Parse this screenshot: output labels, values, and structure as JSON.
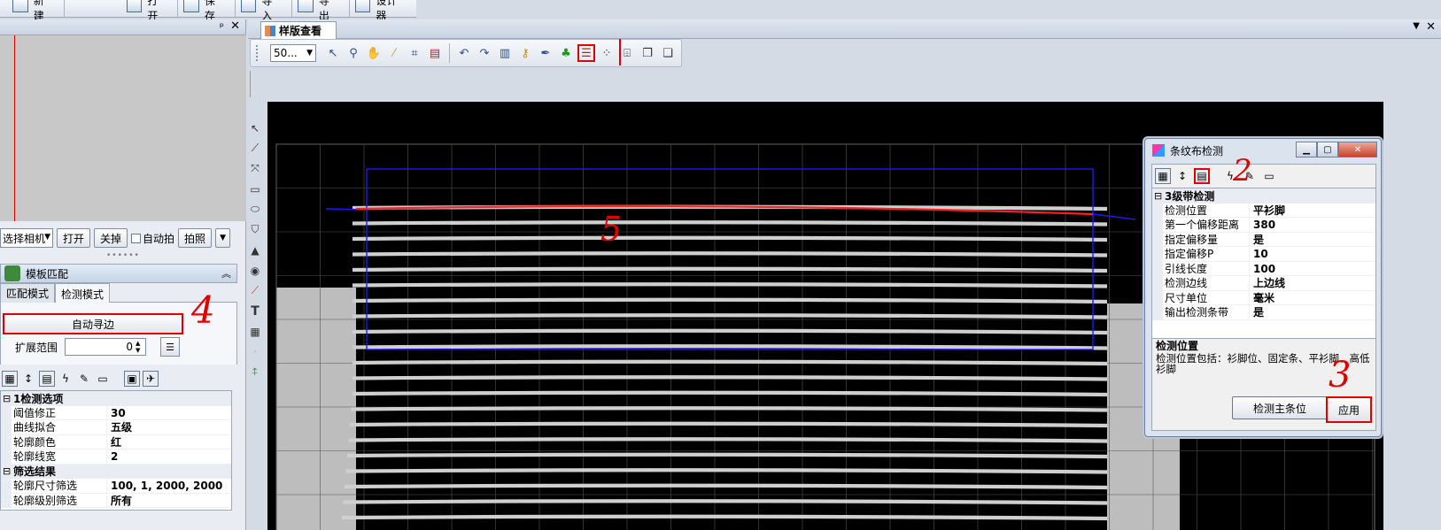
{
  "top_toolbar": {
    "items": [
      {
        "label": "新建",
        "icon": "new-document-icon"
      },
      {
        "label": "打开",
        "icon": "open-folder-icon"
      },
      {
        "label": "保存",
        "icon": "save-disk-icon"
      },
      {
        "label": "导入",
        "icon": "import-icon"
      },
      {
        "label": "导出",
        "icon": "export-icon"
      },
      {
        "label": "设计器",
        "icon": "designer-icon"
      }
    ]
  },
  "left_panel": {
    "pin_glyph": "ᵖ",
    "close_glyph": "✕",
    "camera": {
      "select_value": "选择相机",
      "open_label": "打开",
      "close_label": "关掉",
      "auto_label": "自动拍",
      "shoot_label": "拍照"
    },
    "template_panel": {
      "title": "模板匹配",
      "tabs": [
        "匹配模式",
        "检测模式"
      ],
      "active_tab": 1,
      "auto_edge_label": "自动寻边",
      "expand_label": "扩展范围",
      "expand_value": "0"
    },
    "property_grid": {
      "categories": [
        {
          "title": "1检测选项",
          "rows": [
            {
              "key": "阈值修正",
              "value": "30"
            },
            {
              "key": "曲线拟合",
              "value": "五级"
            },
            {
              "key": "轮廓颜色",
              "value": "红"
            },
            {
              "key": "轮廓线宽",
              "value": "2"
            }
          ]
        },
        {
          "title": "筛选结果",
          "rows": [
            {
              "key": "轮廓尺寸筛选",
              "value": "100, 1, 2000, 2000"
            },
            {
              "key": "轮廓级别筛选",
              "value": "所有"
            }
          ]
        }
      ]
    }
  },
  "document": {
    "tab_title": "样版查看",
    "zoom_value": "50...",
    "dropdown_glyph": "▼",
    "close_glyph": "✕"
  },
  "dialog": {
    "title": "条纹布检测",
    "category": "3级带检测",
    "rows": [
      {
        "key": "检测位置",
        "value": "平衫脚"
      },
      {
        "key": "第一个偏移距离",
        "value": "380"
      },
      {
        "key": "指定偏移量",
        "value": "是"
      },
      {
        "key": "指定偏移P",
        "value": "10"
      },
      {
        "key": "引线长度",
        "value": "100"
      },
      {
        "key": "检测边线",
        "value": "上边线"
      },
      {
        "key": "尺寸单位",
        "value": "毫米"
      },
      {
        "key": "输出检测条带",
        "value": "是"
      }
    ],
    "desc_title": "检测位置",
    "desc_text": "检测位置包括：衫脚位、固定条、平衫脚、高低衫脚",
    "detect_main_label": "检测主条位",
    "apply_label": "应用"
  },
  "annotations": {
    "a2": "2",
    "a3": "3",
    "a4": "4",
    "a5": "5"
  },
  "colors": {
    "annotation_red": "#e00000",
    "roi_blue": "#1a1aff",
    "edge_red": "#ff2020",
    "canvas_bg": "#000000"
  }
}
